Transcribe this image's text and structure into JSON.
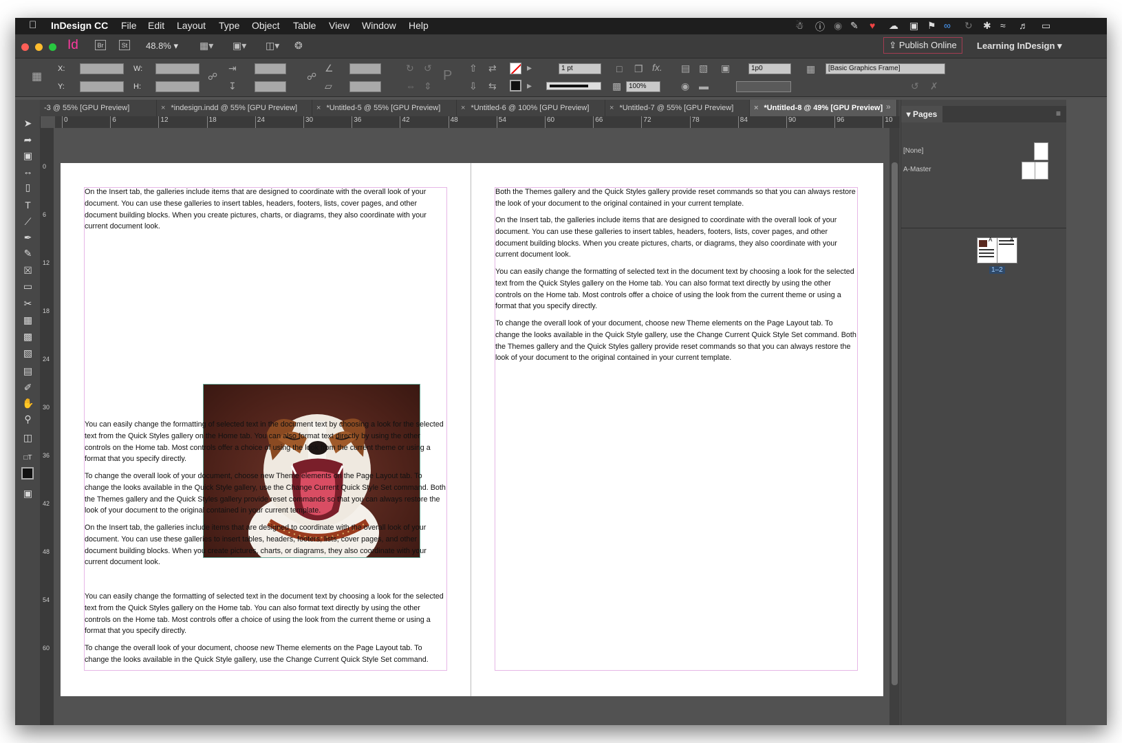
{
  "menubar": {
    "app_name": "InDesign CC",
    "items": [
      "File",
      "Edit",
      "Layout",
      "Type",
      "Object",
      "Table",
      "View",
      "Window",
      "Help"
    ]
  },
  "appbar": {
    "logo": "Id",
    "bridge": "Br",
    "stock": "St",
    "zoom": "48.8%",
    "publish_label": "Publish Online",
    "workspace": "Learning InDesign"
  },
  "control": {
    "x_label": "X:",
    "y_label": "Y:",
    "w_label": "W:",
    "h_label": "H:",
    "stroke_weight": "1 pt",
    "opacity": "100%",
    "offset": "1p0",
    "object_style": "[Basic Graphics Frame]"
  },
  "tabs": [
    {
      "label": "-3 @ 55% [GPU Preview]"
    },
    {
      "label": "*indesign.indd @ 55% [GPU Preview]"
    },
    {
      "label": "*Untitled-5 @ 55% [GPU Preview]"
    },
    {
      "label": "*Untitled-6 @ 100% [GPU Preview]"
    },
    {
      "label": "*Untitled-7 @ 55% [GPU Preview]"
    },
    {
      "label": "*Untitled-8 @ 49% [GPU Preview]"
    }
  ],
  "ruler": {
    "h_ticks": [
      "0",
      "6",
      "12",
      "18",
      "24",
      "30",
      "36",
      "42",
      "48",
      "54",
      "60",
      "66",
      "72",
      "78",
      "84",
      "90",
      "96",
      "10"
    ],
    "v_ticks": [
      "0",
      "6",
      "12",
      "18",
      "24",
      "30",
      "36",
      "42",
      "48",
      "54",
      "60"
    ]
  },
  "document": {
    "left": {
      "p1": "On the Insert tab, the galleries include items that are designed to coordinate with the overall look of your document. You can use these galleries to insert tables, headers, footers, lists, cover pages, and other document building blocks. When you create pictures, charts, or diagrams, they also coordinate with your current document look.",
      "p2": "You can easily change the formatting of selected text in the document text by choosing a look for the selected text from the Quick Styles gallery on the Home tab. You can also format text directly by using the other controls on the Home tab. Most controls offer a choice of using the look from the current theme or using a format that you specify directly.",
      "p3": "To change the overall look of your document, choose new Theme elements on the Page Layout tab. To change the looks available in the Quick Style gallery, use the Change Current Quick Style Set command. Both the Themes gallery and the Quick Styles gallery provide reset commands so that you can always restore the look of your document to the original contained in your current template.",
      "p4": "On the Insert tab, the galleries include items that are designed to coordinate with the overall look of your document. You can use these galleries to insert tables, headers, footers, lists, cover pages, and other document building blocks. When you create pictures, charts, or diagrams, they also coordinate with your current document look.",
      "p5": "You can easily change the formatting of selected text in the document text by choosing a look for the selected text from the Quick Styles gallery on the Home tab. You can also format text directly by using the other controls on the Home tab. Most controls offer a choice of using the look from the current theme or using a format that you specify directly.",
      "p6": "To change the overall look of your document, choose new Theme elements on the Page Layout tab. To change the looks available in the Quick Style gallery, use the Change Current Quick Style Set command."
    },
    "right": {
      "p1": "Both the Themes gallery and the Quick Styles gallery provide reset commands so that you can always restore the look of your document to the original contained in your current template.",
      "p2": "On the Insert tab, the galleries include items that are designed to coordinate with the overall look of your document. You can use these galleries to insert tables, headers, footers, lists, cover pages, and other document building blocks. When you create pictures, charts, or diagrams, they also coordinate with your current document look.",
      "p3": "You can easily change the formatting of selected text in the document text by choosing a look for the selected text from the Quick Styles gallery on the Home tab. You can also format text directly by using the other controls on the Home tab. Most controls offer a choice of using the look from the current theme or using a format that you specify directly.",
      "p4": "To change the overall look of your document, choose new Theme elements on the Page Layout tab. To change the looks available in the Quick Style gallery, use the Change Current Quick Style Set command. Both the Themes gallery and the Quick Styles gallery provide reset commands so that you can always restore the look of your document to the original contained in your current template."
    }
  },
  "pages_panel": {
    "title": "Pages",
    "none_label": "[None]",
    "master_label": "A-Master",
    "spread_label": "1–2",
    "master_prefix": "A"
  },
  "colors": {
    "accent_publish": "#a33c52",
    "indesign_pink": "#ff3aa0",
    "frame_guide": "#e6b6e6"
  }
}
